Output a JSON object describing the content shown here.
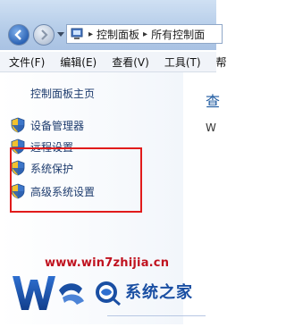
{
  "window": {
    "address": {
      "segments": [
        "控制面板",
        "所有控制面"
      ]
    }
  },
  "menubar": {
    "items": [
      "文件(F)",
      "编辑(E)",
      "查看(V)",
      "工具(T)",
      "帮"
    ]
  },
  "leftpane": {
    "heading": "控制面板主页",
    "links": [
      "设备管理器",
      "远程设置",
      "系统保护",
      "高级系统设置"
    ]
  },
  "content": {
    "title": "查",
    "text": "W"
  },
  "watermark": {
    "url": "www.win7zhijia.cn",
    "logo_text": "系统之家",
    "brand_colors": {
      "red": "#c0121f",
      "blue": "#1a4fa3",
      "highlight": "#e11b1b"
    }
  }
}
